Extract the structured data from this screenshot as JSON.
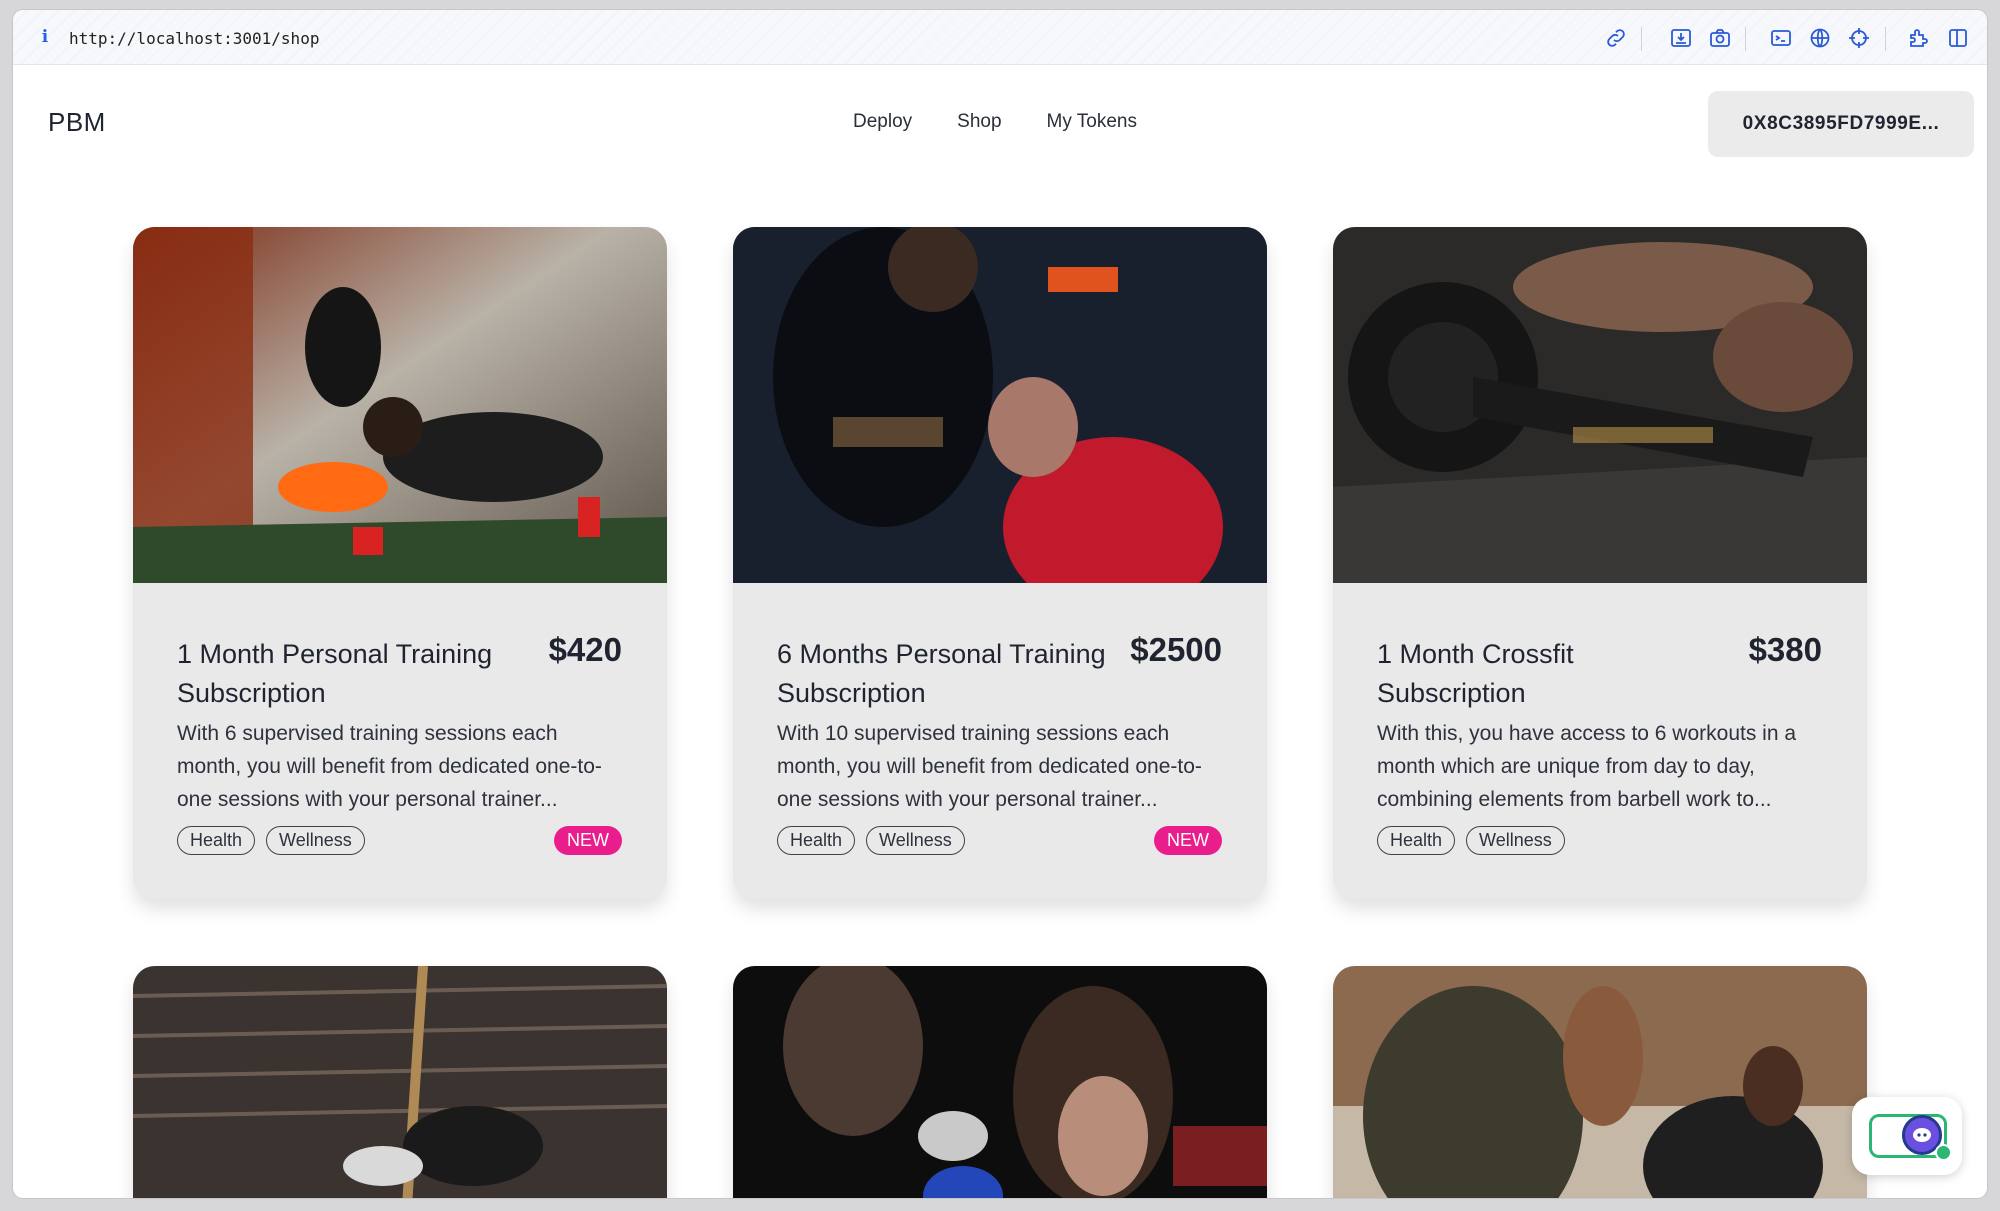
{
  "browser": {
    "url": "http://localhost:3001/shop",
    "icons": [
      "info-icon",
      "link-icon",
      "save-icon",
      "camera-icon",
      "terminal-icon",
      "globe-icon",
      "crosshair-icon",
      "extension-icon",
      "sidebar-icon"
    ]
  },
  "navbar": {
    "logo": "PBM",
    "links": [
      "Deploy",
      "Shop",
      "My Tokens"
    ],
    "wallet": "0X8C3895FD7999E..."
  },
  "colors": {
    "accent": "#e91e8c",
    "card_bg": "#e9e9e9"
  },
  "products": [
    {
      "title": "1 Month Personal Training Subscription",
      "price": "$420",
      "description": "With 6 supervised training sessions each month, you will benefit from dedicated one-to-one sessions with your personal trainer...",
      "tags": [
        "Health",
        "Wellness"
      ],
      "badge": "NEW"
    },
    {
      "title": "6 Months Personal Training Subscription",
      "price": "$2500",
      "description": "With 10 supervised training sessions each month, you will benefit from dedicated one-to-one sessions with your personal trainer...",
      "tags": [
        "Health",
        "Wellness"
      ],
      "badge": "NEW"
    },
    {
      "title": "1 Month Crossfit Subscription",
      "price": "$380",
      "description": "With this, you have access to 6 workouts in a month which are unique from day to day, combining elements from barbell work to...",
      "tags": [
        "Health",
        "Wellness"
      ],
      "badge": ""
    }
  ]
}
